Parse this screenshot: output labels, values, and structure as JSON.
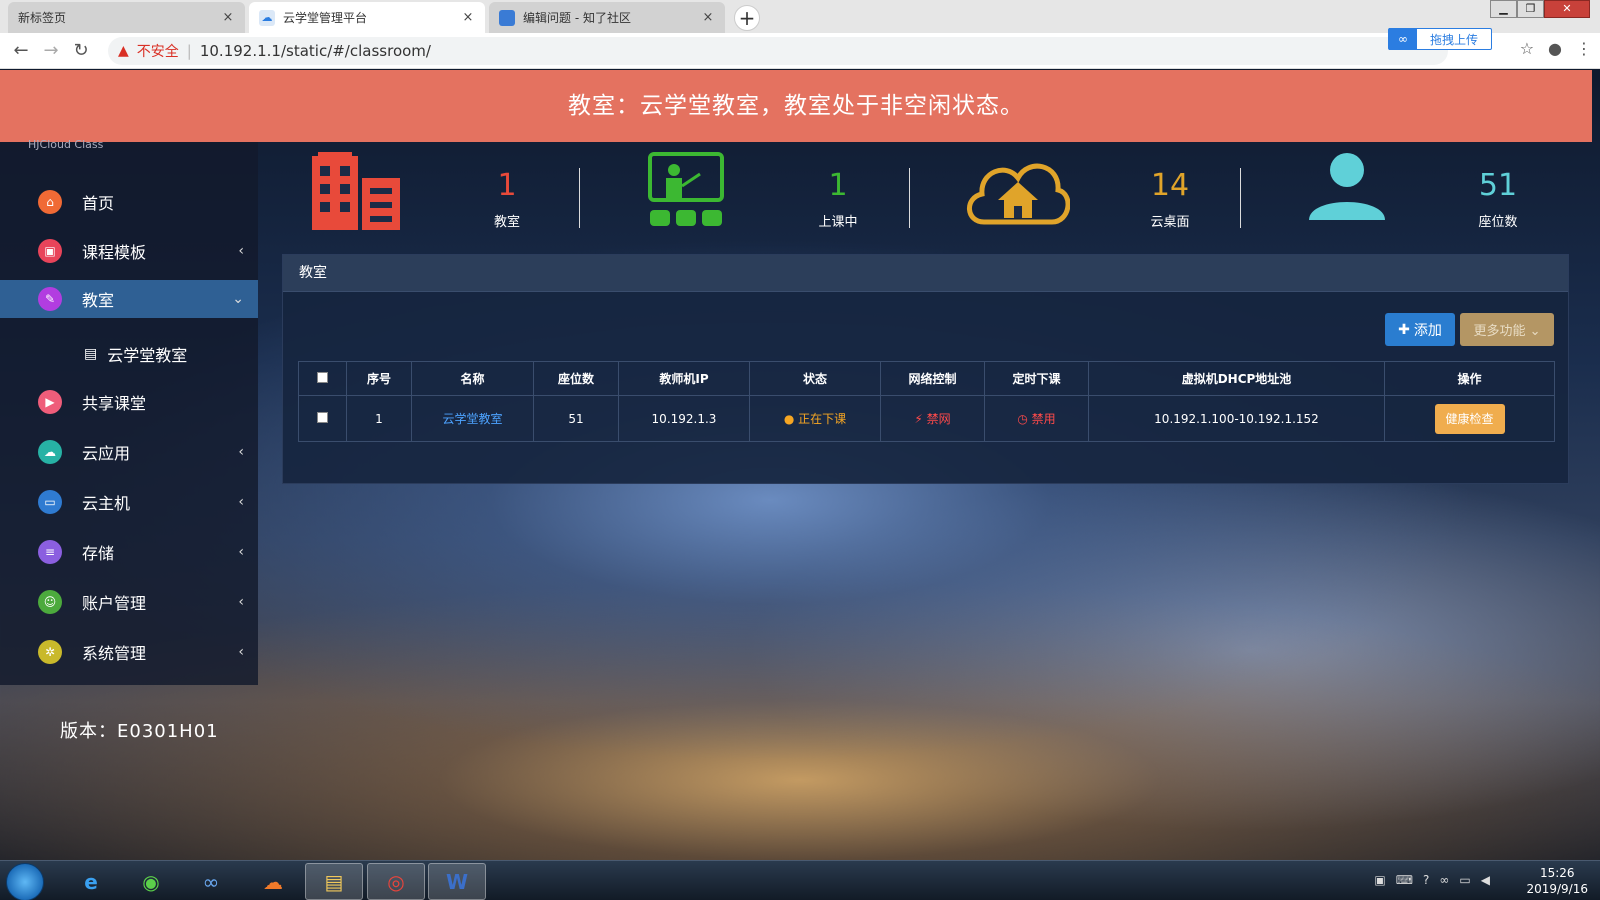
{
  "browser": {
    "tabs": [
      {
        "label": "新标签页",
        "close": "×"
      },
      {
        "label": "云学堂管理平台",
        "close": "×"
      },
      {
        "label": "编辑问题 - 知了社区",
        "close": "×"
      }
    ],
    "newtab": "+",
    "window_buttons": {
      "min": "▁",
      "max": "❐",
      "close": "✕"
    },
    "insecure_label": "不安全",
    "url": "10.192.1.1/static/#/classroom/",
    "upload_button": "拖拽上传"
  },
  "banner": {
    "message": "教室：云学堂教室，教室处于非空闲状态。"
  },
  "sidebar": {
    "logo_fragment": "HJCloud Class",
    "items": [
      {
        "label": "首页",
        "icon": "home-icon",
        "color": "#f06a35"
      },
      {
        "label": "课程模板",
        "icon": "template-icon",
        "color": "#e8445a",
        "chevron": "‹"
      },
      {
        "label": "教室",
        "icon": "classroom-icon",
        "color": "#b23de0",
        "chevron": "⌄"
      },
      {
        "label": "共享课堂",
        "icon": "share-icon",
        "color": "#ef5d7a"
      },
      {
        "label": "云应用",
        "icon": "cloud-app-icon",
        "color": "#27b2a5",
        "chevron": "‹"
      },
      {
        "label": "云主机",
        "icon": "host-icon",
        "color": "#2f7bd1",
        "chevron": "‹"
      },
      {
        "label": "存储",
        "icon": "storage-icon",
        "color": "#8b5fe0",
        "chevron": "‹"
      },
      {
        "label": "账户管理",
        "icon": "account-icon",
        "color": "#4caa3d",
        "chevron": "‹"
      },
      {
        "label": "系统管理",
        "icon": "settings-icon",
        "color": "#c9b92b",
        "chevron": "‹"
      }
    ],
    "submenu_item": "云学堂教室",
    "version": "版本：E0301H01"
  },
  "stats": [
    {
      "value": "1",
      "label": "教室",
      "color": "#e84a3a"
    },
    {
      "value": "1",
      "label": "上课中",
      "color": "#3cb832"
    },
    {
      "value": "14",
      "label": "云桌面",
      "color": "#e0a42a"
    },
    {
      "value": "51",
      "label": "座位数",
      "color": "#5fd0d8"
    }
  ],
  "panel": {
    "title": "教室",
    "add_button": "添加",
    "more_button": "更多功能 ⌄",
    "columns": [
      "",
      "序号",
      "名称",
      "座位数",
      "教师机IP",
      "状态",
      "网络控制",
      "定时下课",
      "虚拟机DHCP地址池",
      "操作"
    ],
    "rows": [
      {
        "index": "1",
        "name": "云学堂教室",
        "seats": "51",
        "teacher_ip": "10.192.1.3",
        "status": "正在下课",
        "network": "禁网",
        "timer": "禁用",
        "dhcp": "10.192.1.100-10.192.1.152",
        "action": "健康检查"
      }
    ]
  },
  "taskbar": {
    "time": "15:26",
    "date": "2019/9/16"
  }
}
